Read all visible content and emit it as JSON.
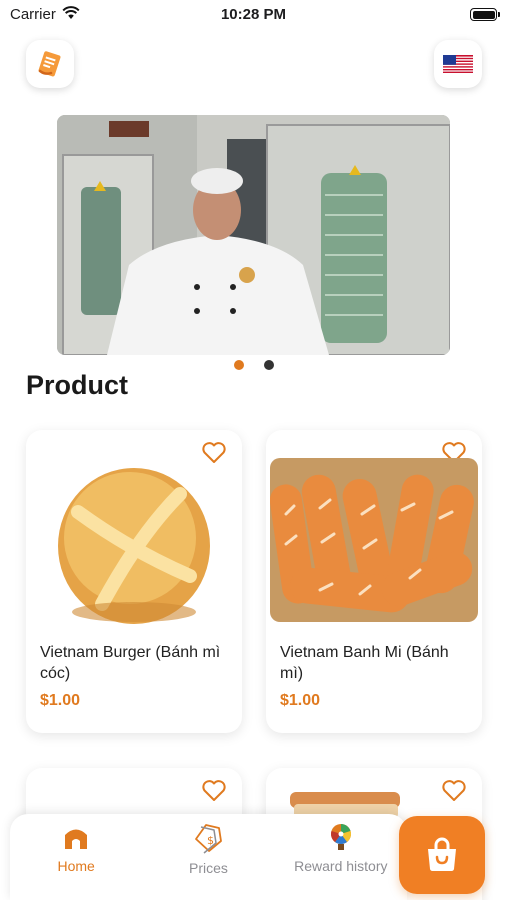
{
  "status_bar": {
    "carrier": "Carrier",
    "time": "10:28 PM"
  },
  "header": {
    "menu_icon": "order-list-icon",
    "language_icon": "us-flag-icon"
  },
  "banner": {
    "slides": 2,
    "active_slide": 1
  },
  "section": {
    "title": "Product"
  },
  "products": [
    {
      "name": "Vietnam Burger (Bánh mì cóc)",
      "price": "$1.00"
    },
    {
      "name": "Vietnam Banh Mi (Bánh mì)",
      "price": "$1.00"
    },
    {
      "name": "",
      "price": ""
    },
    {
      "name": "",
      "price": ""
    }
  ],
  "tabs": [
    {
      "label": "Home",
      "icon": "home-icon",
      "active": true
    },
    {
      "label": "Prices",
      "icon": "price-tag-icon",
      "active": false
    },
    {
      "label": "Reward history",
      "icon": "prize-wheel-icon",
      "active": false
    }
  ],
  "colors": {
    "accent": "#e07a1f",
    "cart": "#f07f24",
    "inactive": "#8e8e93"
  }
}
